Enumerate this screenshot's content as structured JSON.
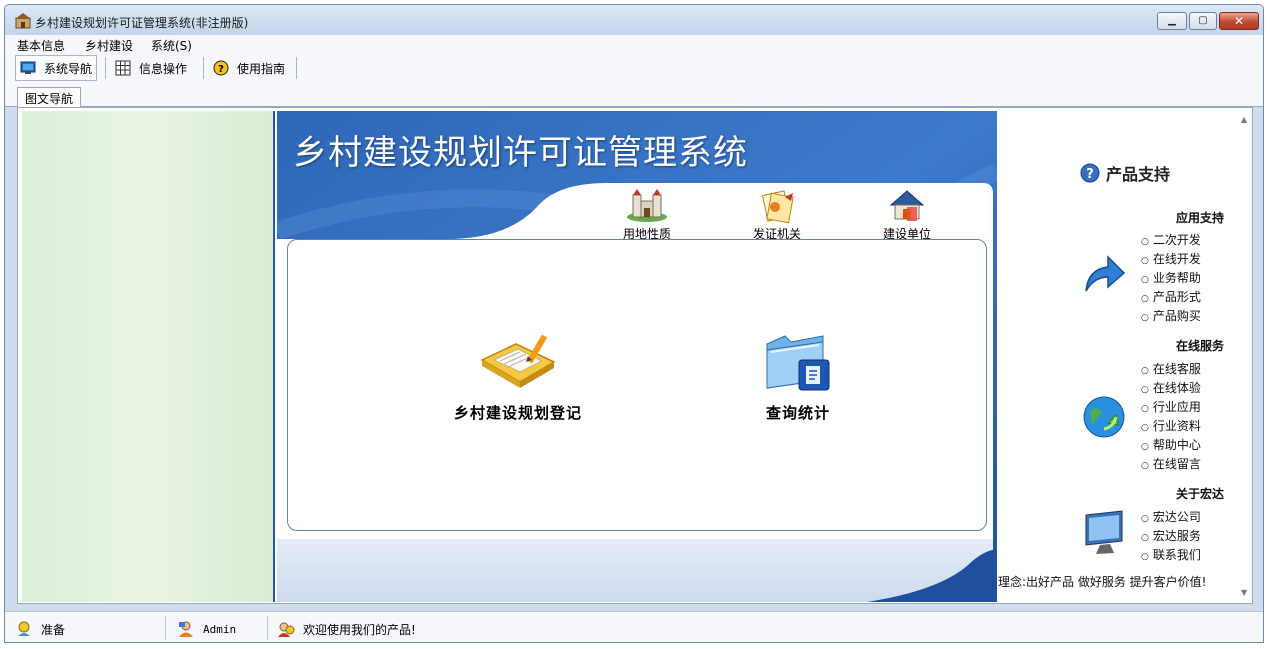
{
  "window": {
    "title": "乡村建设规划许可证管理系统(非注册版)",
    "controls": [
      "minimize",
      "maximize",
      "close"
    ]
  },
  "menubar": {
    "items": [
      {
        "label": "基本信息"
      },
      {
        "label": "乡村建设"
      },
      {
        "label": "系统(S)"
      }
    ]
  },
  "toolbar": {
    "items": [
      {
        "label": "系统导航",
        "icon": "monitor-icon",
        "selected": true
      },
      {
        "label": "信息操作",
        "icon": "grid-icon",
        "selected": false
      },
      {
        "label": "使用指南",
        "icon": "help-icon",
        "selected": false
      }
    ]
  },
  "tabs": [
    {
      "label": "图文导航",
      "active": true
    }
  ],
  "center": {
    "banner_title": "乡村建设规划许可证管理系统",
    "quick_links": [
      {
        "label": "用地性质",
        "icon": "castle-icon"
      },
      {
        "label": "发证机关",
        "icon": "certificate-icon"
      },
      {
        "label": "建设单位",
        "icon": "house-icon"
      }
    ],
    "main_items": [
      {
        "label": "乡村建设规划登记",
        "icon": "register-notebook-icon"
      },
      {
        "label": "查询统计",
        "icon": "folder-document-icon"
      }
    ]
  },
  "right_panel": {
    "header": "产品支持",
    "sections": [
      {
        "title": "应用支持",
        "icon": "blue-arrow-icon",
        "items": [
          "二次开发",
          "在线开发",
          "业务帮助",
          "产品形式",
          "产品购买"
        ]
      },
      {
        "title": "在线服务",
        "icon": "globe-refresh-icon",
        "items": [
          "在线客服",
          "在线体验",
          "行业应用",
          "行业资料",
          "帮助中心",
          "在线留言"
        ]
      },
      {
        "title": "关于宏达",
        "icon": "monitor-display-icon",
        "items": [
          "宏达公司",
          "宏达服务",
          "联系我们"
        ]
      }
    ],
    "slogan": "理念:出好产品 做好服务 提升客户价值!"
  },
  "statusbar": {
    "status": "准备",
    "user": "Admin",
    "message": "欢迎使用我们的产品!"
  },
  "colors": {
    "banner_blue": "#2e63b0",
    "left_panel_green": "#dcefd9",
    "window_frame": "#cfdcec"
  }
}
